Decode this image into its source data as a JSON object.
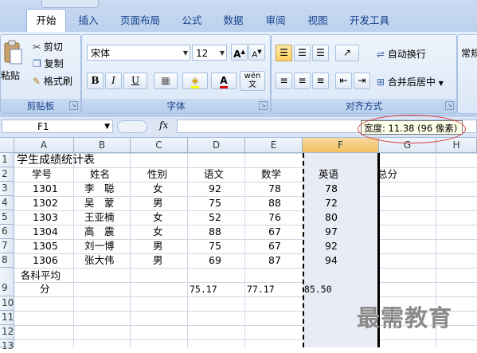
{
  "ribbon": {
    "tabs": [
      "开始",
      "插入",
      "页面布局",
      "公式",
      "数据",
      "审阅",
      "视图",
      "开发工具"
    ],
    "clipboard": {
      "paste_label": "粘贴",
      "cut_label": "剪切",
      "copy_label": "复制",
      "format_painter_label": "格式刷",
      "group_label": "剪贴板"
    },
    "font": {
      "font_name": "宋体",
      "font_size": "12",
      "bold": "B",
      "italic": "I",
      "underline": "U",
      "grow": "A",
      "shrink": "A",
      "phonetic": "wén",
      "group_label": "字体"
    },
    "alignment": {
      "wrap_text_label": "自动换行",
      "merge_center_label": "合并后居中",
      "group_label": "对齐方式"
    },
    "number": {
      "format_label": "常规"
    }
  },
  "formula_bar": {
    "name_box": "F1",
    "fx": "fx",
    "value": ""
  },
  "tooltip": {
    "text": "宽度: 11.38 (96 像素)"
  },
  "columns": [
    "A",
    "B",
    "C",
    "D",
    "E",
    "F",
    "G",
    "H"
  ],
  "rows": [
    "1",
    "2",
    "3",
    "4",
    "5",
    "6",
    "7",
    "8",
    "9",
    "10",
    "11",
    "12",
    "13"
  ],
  "sheet": {
    "title": "学生成绩统计表",
    "headers": [
      "学号",
      "姓名",
      "性别",
      "语文",
      "数学",
      "英语",
      "总分"
    ],
    "records": [
      [
        "1301",
        "李　聪",
        "女",
        "92",
        "78",
        "78"
      ],
      [
        "1302",
        "吴　蒙",
        "男",
        "75",
        "88",
        "72"
      ],
      [
        "1303",
        "王亚楠",
        "女",
        "52",
        "76",
        "80"
      ],
      [
        "1304",
        "高　震",
        "女",
        "88",
        "67",
        "97"
      ],
      [
        "1305",
        "刘一博",
        "男",
        "75",
        "67",
        "92"
      ],
      [
        "1306",
        "张大伟",
        "男",
        "69",
        "87",
        "94"
      ]
    ],
    "avg_label_line1": "各科平均",
    "avg_label_line2": "分",
    "averages": [
      "75.17",
      "77.17",
      "85.50"
    ]
  },
  "watermark": "最需教育"
}
